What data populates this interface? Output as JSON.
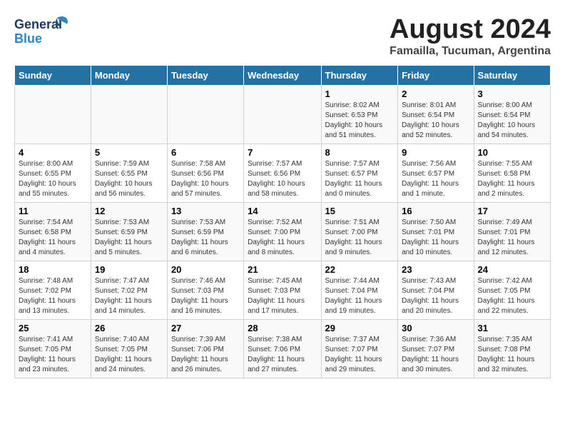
{
  "header": {
    "logo_general": "General",
    "logo_blue": "Blue",
    "main_title": "August 2024",
    "subtitle": "Famailla, Tucuman, Argentina"
  },
  "calendar": {
    "columns": [
      "Sunday",
      "Monday",
      "Tuesday",
      "Wednesday",
      "Thursday",
      "Friday",
      "Saturday"
    ],
    "weeks": [
      {
        "days": [
          {
            "number": "",
            "info": ""
          },
          {
            "number": "",
            "info": ""
          },
          {
            "number": "",
            "info": ""
          },
          {
            "number": "",
            "info": ""
          },
          {
            "number": "1",
            "info": "Sunrise: 8:02 AM\nSunset: 6:53 PM\nDaylight: 10 hours\nand 51 minutes."
          },
          {
            "number": "2",
            "info": "Sunrise: 8:01 AM\nSunset: 6:54 PM\nDaylight: 10 hours\nand 52 minutes."
          },
          {
            "number": "3",
            "info": "Sunrise: 8:00 AM\nSunset: 6:54 PM\nDaylight: 10 hours\nand 54 minutes."
          }
        ]
      },
      {
        "days": [
          {
            "number": "4",
            "info": "Sunrise: 8:00 AM\nSunset: 6:55 PM\nDaylight: 10 hours\nand 55 minutes."
          },
          {
            "number": "5",
            "info": "Sunrise: 7:59 AM\nSunset: 6:55 PM\nDaylight: 10 hours\nand 56 minutes."
          },
          {
            "number": "6",
            "info": "Sunrise: 7:58 AM\nSunset: 6:56 PM\nDaylight: 10 hours\nand 57 minutes."
          },
          {
            "number": "7",
            "info": "Sunrise: 7:57 AM\nSunset: 6:56 PM\nDaylight: 10 hours\nand 58 minutes."
          },
          {
            "number": "8",
            "info": "Sunrise: 7:57 AM\nSunset: 6:57 PM\nDaylight: 11 hours\nand 0 minutes."
          },
          {
            "number": "9",
            "info": "Sunrise: 7:56 AM\nSunset: 6:57 PM\nDaylight: 11 hours\nand 1 minute."
          },
          {
            "number": "10",
            "info": "Sunrise: 7:55 AM\nSunset: 6:58 PM\nDaylight: 11 hours\nand 2 minutes."
          }
        ]
      },
      {
        "days": [
          {
            "number": "11",
            "info": "Sunrise: 7:54 AM\nSunset: 6:58 PM\nDaylight: 11 hours\nand 4 minutes."
          },
          {
            "number": "12",
            "info": "Sunrise: 7:53 AM\nSunset: 6:59 PM\nDaylight: 11 hours\nand 5 minutes."
          },
          {
            "number": "13",
            "info": "Sunrise: 7:53 AM\nSunset: 6:59 PM\nDaylight: 11 hours\nand 6 minutes."
          },
          {
            "number": "14",
            "info": "Sunrise: 7:52 AM\nSunset: 7:00 PM\nDaylight: 11 hours\nand 8 minutes."
          },
          {
            "number": "15",
            "info": "Sunrise: 7:51 AM\nSunset: 7:00 PM\nDaylight: 11 hours\nand 9 minutes."
          },
          {
            "number": "16",
            "info": "Sunrise: 7:50 AM\nSunset: 7:01 PM\nDaylight: 11 hours\nand 10 minutes."
          },
          {
            "number": "17",
            "info": "Sunrise: 7:49 AM\nSunset: 7:01 PM\nDaylight: 11 hours\nand 12 minutes."
          }
        ]
      },
      {
        "days": [
          {
            "number": "18",
            "info": "Sunrise: 7:48 AM\nSunset: 7:02 PM\nDaylight: 11 hours\nand 13 minutes."
          },
          {
            "number": "19",
            "info": "Sunrise: 7:47 AM\nSunset: 7:02 PM\nDaylight: 11 hours\nand 14 minutes."
          },
          {
            "number": "20",
            "info": "Sunrise: 7:46 AM\nSunset: 7:03 PM\nDaylight: 11 hours\nand 16 minutes."
          },
          {
            "number": "21",
            "info": "Sunrise: 7:45 AM\nSunset: 7:03 PM\nDaylight: 11 hours\nand 17 minutes."
          },
          {
            "number": "22",
            "info": "Sunrise: 7:44 AM\nSunset: 7:04 PM\nDaylight: 11 hours\nand 19 minutes."
          },
          {
            "number": "23",
            "info": "Sunrise: 7:43 AM\nSunset: 7:04 PM\nDaylight: 11 hours\nand 20 minutes."
          },
          {
            "number": "24",
            "info": "Sunrise: 7:42 AM\nSunset: 7:05 PM\nDaylight: 11 hours\nand 22 minutes."
          }
        ]
      },
      {
        "days": [
          {
            "number": "25",
            "info": "Sunrise: 7:41 AM\nSunset: 7:05 PM\nDaylight: 11 hours\nand 23 minutes."
          },
          {
            "number": "26",
            "info": "Sunrise: 7:40 AM\nSunset: 7:05 PM\nDaylight: 11 hours\nand 24 minutes."
          },
          {
            "number": "27",
            "info": "Sunrise: 7:39 AM\nSunset: 7:06 PM\nDaylight: 11 hours\nand 26 minutes."
          },
          {
            "number": "28",
            "info": "Sunrise: 7:38 AM\nSunset: 7:06 PM\nDaylight: 11 hours\nand 27 minutes."
          },
          {
            "number": "29",
            "info": "Sunrise: 7:37 AM\nSunset: 7:07 PM\nDaylight: 11 hours\nand 29 minutes."
          },
          {
            "number": "30",
            "info": "Sunrise: 7:36 AM\nSunset: 7:07 PM\nDaylight: 11 hours\nand 30 minutes."
          },
          {
            "number": "31",
            "info": "Sunrise: 7:35 AM\nSunset: 7:08 PM\nDaylight: 11 hours\nand 32 minutes."
          }
        ]
      }
    ]
  }
}
